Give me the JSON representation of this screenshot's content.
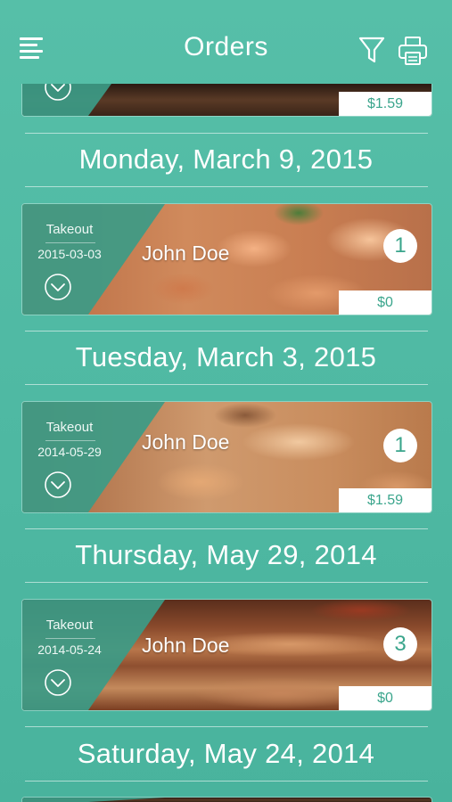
{
  "header": {
    "title": "Orders"
  },
  "top_card": {
    "price": "$1.59"
  },
  "groups": [
    {
      "date": "Monday, March 9, 2015",
      "order": {
        "type": "Takeout",
        "date": "2015-03-03",
        "name": "John Doe",
        "count": "1",
        "price": "$0"
      }
    },
    {
      "date": "Tuesday, March 3, 2015",
      "order": {
        "type": "Takeout",
        "date": "2014-05-29",
        "name": "John Doe",
        "count": "1",
        "price": "$1.59"
      }
    },
    {
      "date": "Thursday, May 29, 2014",
      "order": {
        "type": "Takeout",
        "date": "2014-05-24",
        "name": "John Doe",
        "count": "3",
        "price": "$0"
      }
    },
    {
      "date": "Saturday, May 24, 2014"
    }
  ],
  "colors": {
    "background": "#4fb9a3",
    "panel": "#3c9b87",
    "accent": "#3aa58c",
    "text": "#ffffff"
  },
  "icons": {
    "menu": "menu-icon",
    "filter": "filter-icon",
    "print": "printer-icon",
    "expand": "chevron-down-circle-icon"
  }
}
